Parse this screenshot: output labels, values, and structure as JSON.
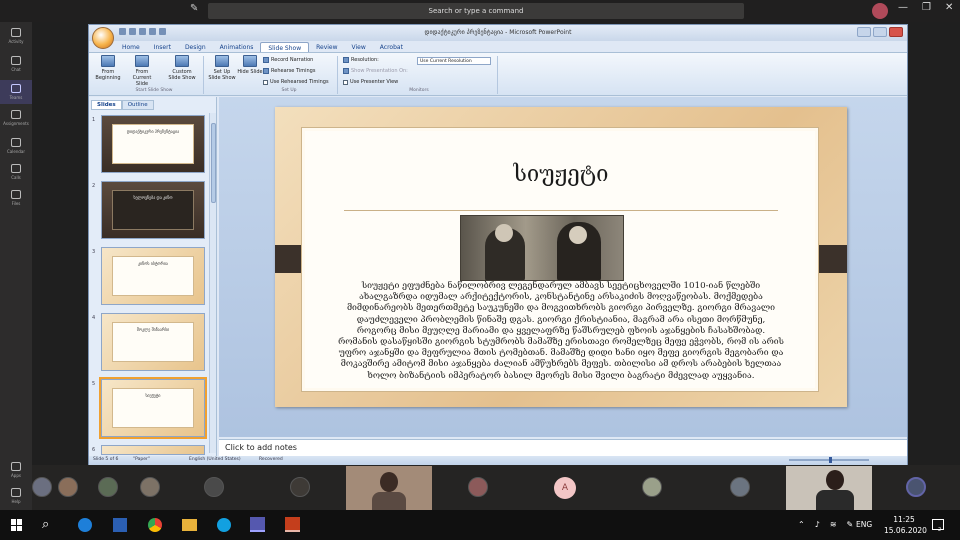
{
  "teams": {
    "search_placeholder": "Search or type a command",
    "rail": [
      {
        "label": "Activity"
      },
      {
        "label": "Chat"
      },
      {
        "label": "Teams"
      },
      {
        "label": "Assignments"
      },
      {
        "label": "Calendar"
      },
      {
        "label": "Calls"
      },
      {
        "label": "Files"
      },
      {
        "label": "Apps"
      },
      {
        "label": "Help"
      }
    ],
    "participant_initial": "A"
  },
  "ppt": {
    "window_title": "დიდაქტიკური პრეზენტაცია - Microsoft PowerPoint",
    "tabs": [
      "Home",
      "Insert",
      "Design",
      "Animations",
      "Slide Show",
      "Review",
      "View",
      "Acrobat"
    ],
    "active_tab": "Slide Show",
    "ribbon": {
      "from_beginning": "From Beginning",
      "from_current": "From Current Slide",
      "custom_show": "Custom Slide Show",
      "group_start": "Start Slide Show",
      "setup_show": "Set Up Slide Show",
      "hide_slide": "Hide Slide",
      "record_narration": "Record Narration",
      "rehearse_timings": "Rehearse Timings",
      "use_rehearsed": "Use Rehearsed Timings",
      "group_setup": "Set Up",
      "resolution_label": "Resolution:",
      "resolution_value": "Use Current Resolution",
      "show_on": "Show Presentation On:",
      "presenter_view": "Use Presenter View",
      "group_monitors": "Monitors"
    },
    "pane_tabs": [
      "Slides",
      "Outline"
    ],
    "thumbs": [
      {
        "num": "1",
        "text": "დიდაქტიკური პრეზენტაცია"
      },
      {
        "num": "2",
        "text": "ხელოვნება და კინო"
      },
      {
        "num": "3",
        "text": "კინოს ისტორია"
      },
      {
        "num": "4",
        "text": "მოკლე შინაარსი"
      },
      {
        "num": "5",
        "text": "სიუჟეტი"
      },
      {
        "num": "6",
        "text": ""
      }
    ],
    "slide": {
      "title": "სიუჟეტი",
      "body": "სიუჟეტი ეფუძნება ნაწილობრივ ლეგენდარულ ამბავს სეეტიცხოველში 1010-იან წლებში ახალგაზრდა იდუმალ არქიტექტორის, კონსტანტინე არსაკიძის მოღვაწეობას. მოქმედება მიმდინარეობს მეთერთმეტე საუკუნეში და მოგვითხრობს გიორგი პირველზე. გიორგი მრავალი დაუძლეველი პრობლემის წინაშე დგას. გიორგი ქრისტიანია, მაგრამ არა ისეთი მორწმუნე, როგორც მისი მეუღლე მარიამი და ყველაფრზე წაშსრულებ ფხოის აჯანყების ჩასახშობად. რომანის დასაწყისში გიორგის სტუმრობს მამაშზე ერისთავი რომელზეც მეფე ეჭვობს, რომ ის არის უფრო აჯანყში და მეფრულია მთის ტომებთან. მამაშზე დიდი ხანი იყო მეფე გიორგის მეგობარი და მოკავშირე ამიტომ მისი აჯანყება ძალიან ამწუხრებს მეფეს. თბილისი ამ დროს არაბების ხელთაა ხოლო ბიზანტიის იმპერატორ ბასილ მეორეს მისი შვილი ბაგრატი მძევლად აუყვანია."
    },
    "notes_placeholder": "Click to add notes",
    "status": {
      "slide": "Slide 5 of 6",
      "theme": "\"Paper\"",
      "language": "English (United States)",
      "recovered": "Recovered"
    }
  },
  "taskbar": {
    "time": "11:25",
    "date": "15.06.2020",
    "lang": "ENG",
    "notif_count": "2"
  }
}
